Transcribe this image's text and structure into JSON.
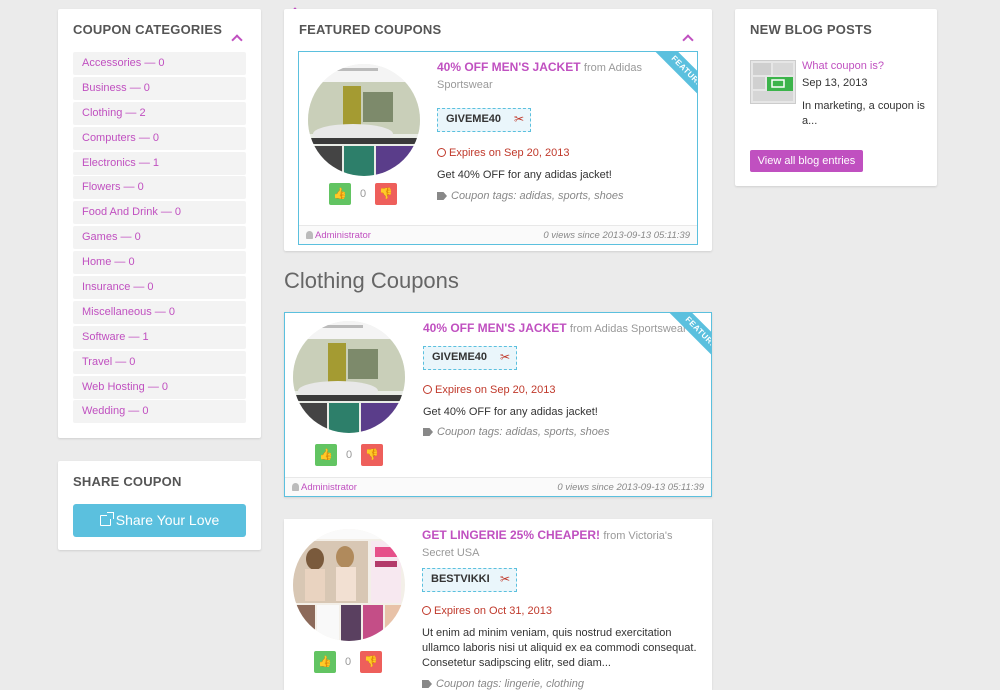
{
  "categories_panel": {
    "title": "COUPON CATEGORIES",
    "items": [
      "Accessories — 0",
      "Business — 0",
      "Clothing — 2",
      "Computers — 0",
      "Electronics — 1",
      "Flowers — 0",
      "Food And Drink — 0",
      "Games — 0",
      "Home — 0",
      "Insurance — 0",
      "Miscellaneous — 0",
      "Software — 1",
      "Travel — 0",
      "Web Hosting — 0",
      "Wedding — 0"
    ]
  },
  "share_panel": {
    "title": "SHARE COUPON",
    "button_label": "Share Your Love"
  },
  "featured_panel": {
    "title": "FEATURED COUPONS"
  },
  "section_heading": "Clothing Coupons",
  "coupons": [
    {
      "title": "40% OFF MEN'S JACKET",
      "from": "from Adidas Sportswear",
      "code": "GIVEME40",
      "expires": "Expires on Sep 20, 2013",
      "description": "Get 40% OFF for any adidas jacket!",
      "tags": "Coupon tags: adidas, sports, shoes",
      "votes": "0",
      "author": "Administrator",
      "views": "0 views since 2013-09-13 05:11:39",
      "ribbon": "FEATURED"
    },
    {
      "title": "40% OFF MEN'S JACKET",
      "from": "from Adidas Sportswear",
      "code": "GIVEME40",
      "expires": "Expires on Sep 20, 2013",
      "description": "Get 40% OFF for any adidas jacket!",
      "tags": "Coupon tags: adidas, sports, shoes",
      "votes": "0",
      "author": "Administrator",
      "views": "0 views since 2013-09-13 05:11:39",
      "ribbon": "FEATURED"
    },
    {
      "title": "GET LINGERIE 25% CHEAPER!",
      "from": "from Victoria's Secret USA",
      "code": "BESTVIKKI",
      "expires": "Expires on Oct 31, 2013",
      "description": "Ut enim ad minim veniam, quis nostrud exercitation ullamco laboris nisi ut aliquid ex ea commodi consequat. Consetetur sadipscing elitr, sed diam...",
      "tags": "Coupon tags: lingerie, clothing",
      "votes": "0"
    }
  ],
  "blog_panel": {
    "title": "NEW BLOG POSTS",
    "post_title": "What coupon is?",
    "post_date": "Sep 13, 2013",
    "post_excerpt": "In marketing, a coupon is a...",
    "button_label": "View all blog entries"
  },
  "colors": {
    "accent": "#c050c0",
    "info": "#5bc0de",
    "success": "#62c462",
    "danger": "#ee5f5b"
  },
  "icons": [
    "chevron-up-icon",
    "external-link-icon",
    "scissors-icon",
    "clock-icon",
    "tag-icon",
    "thumbs-up-icon",
    "thumbs-down-icon",
    "user-icon"
  ]
}
